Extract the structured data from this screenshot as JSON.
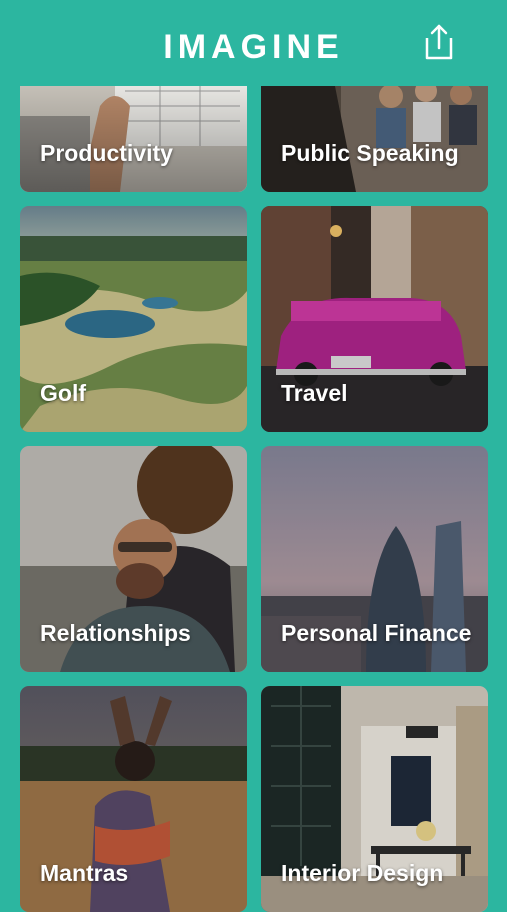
{
  "header": {
    "title": "IMAGINE",
    "share_icon": "share-icon"
  },
  "categories": [
    {
      "label": "Productivity"
    },
    {
      "label": "Public Speaking"
    },
    {
      "label": "Golf"
    },
    {
      "label": "Travel"
    },
    {
      "label": "Relationships"
    },
    {
      "label": "Personal Finance"
    },
    {
      "label": "Mantras"
    },
    {
      "label": "Interior Design"
    }
  ],
  "colors": {
    "background": "#2cb6a0",
    "text": "#ffffff"
  }
}
